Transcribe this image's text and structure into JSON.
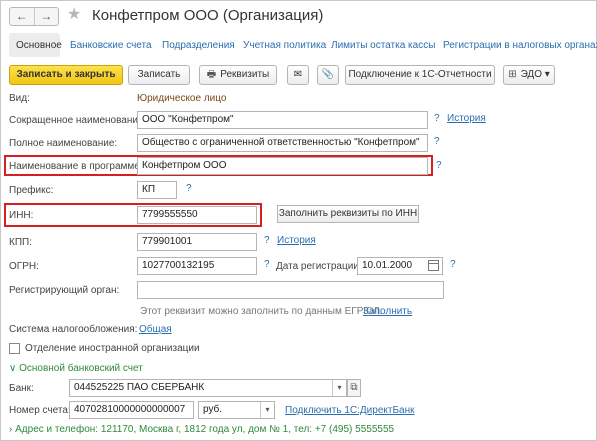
{
  "window": {
    "title": "Конфетпром ООО (Организация)",
    "nav_back": "←",
    "nav_forward": "→",
    "favorite_icon": "★"
  },
  "tabs": [
    {
      "label": "Основное"
    },
    {
      "label": "Банковские счета"
    },
    {
      "label": "Подразделения"
    },
    {
      "label": "Учетная политика"
    },
    {
      "label": "Лимиты остатка кассы"
    },
    {
      "label": "Регистрации в налоговых органах"
    }
  ],
  "toolbar": {
    "save_close": "Записать и закрыть",
    "save": "Записать",
    "print_icon": "🖶",
    "requisites": "Реквизиты",
    "mail_icon": "✉",
    "attach_icon": "📎",
    "connect": "Подключение к 1С-Отчетности",
    "edo_icon": "⊞",
    "edo": "ЭДО",
    "edo_caret": "▾"
  },
  "form": {
    "kind_label": "Вид:",
    "kind_value": "Юридическое лицо",
    "short_name_label": "Сокращенное наименование:",
    "short_name_value": "ООО \"Конфетпром\"",
    "full_name_label": "Полное наименование:",
    "full_name_value": "Общество с ограниченной ответственностью \"Конфетпром\"",
    "program_name_label": "Наименование в программе:",
    "program_name_value": "Конфетпром ООО",
    "prefix_label": "Префикс:",
    "prefix_value": "КП",
    "inn_label": "ИНН:",
    "inn_value": "7799555550",
    "fill_by_inn": "Заполнить реквизиты по ИНН",
    "kpp_label": "КПП:",
    "kpp_value": "779901001",
    "ogrn_label": "ОГРН:",
    "ogrn_value": "1027700132195",
    "reg_date_label": "Дата регистрации:",
    "reg_date_value": "10.01.2000",
    "reg_organ_label": "Регистрирующий орган:",
    "reg_organ_value": "",
    "egrul_hint": "Этот реквизит можно заполнить по данным ЕГРЮЛ.",
    "fill_link": "Заполнить",
    "tax_system_label": "Система налогообложения:",
    "tax_system_link": "Общая",
    "foreign_division_label": "Отделение иностранной организации",
    "history": "История",
    "help": "?",
    "bank_section": "Основной банковский счет",
    "bank_label": "Банк:",
    "bank_value": "044525225 ПАО СБЕРБАНК",
    "account_label": "Номер счета:",
    "account_value": "40702810000000000007",
    "currency_value": "руб.",
    "directbank_link": "Подключить 1С:ДиректБанк",
    "address_section": "Адрес и телефон: 121170, Москва г, 1812 года ул, дом № 1, тел: +7 (495) 5555555",
    "section_caret": "∨",
    "caret_right": "›",
    "select_caret": "▾",
    "search_icon": "⧉"
  },
  "colors": {
    "accent": "#f1c515",
    "link": "#2a6fb0",
    "highlight": "#d42020",
    "section": "#2f8a3b"
  }
}
